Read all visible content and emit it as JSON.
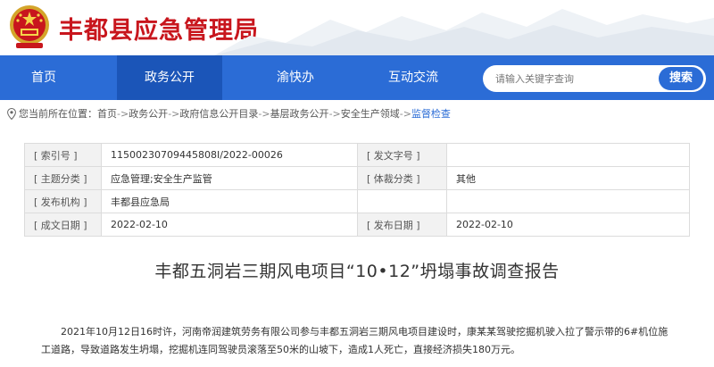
{
  "header": {
    "site_title": "丰都县应急管理局",
    "brand_color": "#c8161d"
  },
  "nav": {
    "items": [
      {
        "label": "首页"
      },
      {
        "label": "政务公开"
      },
      {
        "label": "渝快办"
      },
      {
        "label": "互动交流"
      }
    ],
    "active_index": 1,
    "color": "#2b6cd6",
    "search": {
      "placeholder": "请输入关键字查询",
      "button_label": "搜索"
    }
  },
  "breadcrumb": {
    "prefix": "您当前所在位置：",
    "items": [
      "首页",
      "政务公开",
      "政府信息公开目录",
      "基层政务公开",
      "安全生产领域",
      "监督检查"
    ],
    "separator": "->"
  },
  "info": {
    "rows": [
      {
        "label1": "[ 索引号 ]",
        "value1": "11500230709445808I/2022-00026",
        "label2": "[ 发文字号 ]",
        "value2": ""
      },
      {
        "label1": "[ 主题分类 ]",
        "value1": "应急管理;安全生产监管",
        "label2": "[ 体裁分类 ]",
        "value2": "其他"
      },
      {
        "label1": "[ 发布机构 ]",
        "value1": "丰都县应急局",
        "label2": "",
        "value2": ""
      },
      {
        "label1": "[ 成文日期 ]",
        "value1": "2022-02-10",
        "label2": "[ 发布日期 ]",
        "value2": "2022-02-10"
      }
    ]
  },
  "article": {
    "title": "丰都五洞岩三期风电项目“10•12”坍塌事故调查报告",
    "paragraph": "2021年10月12日16时许，河南帝润建筑劳务有限公司参与丰都五洞岩三期风电项目建设时，康某某驾驶挖掘机驶入拉了警示带的6#机位施工道路，导致道路发生坍塌，挖掘机连同驾驶员滚落至50米的山坡下，造成1人死亡，直接经济损失180万元。"
  }
}
